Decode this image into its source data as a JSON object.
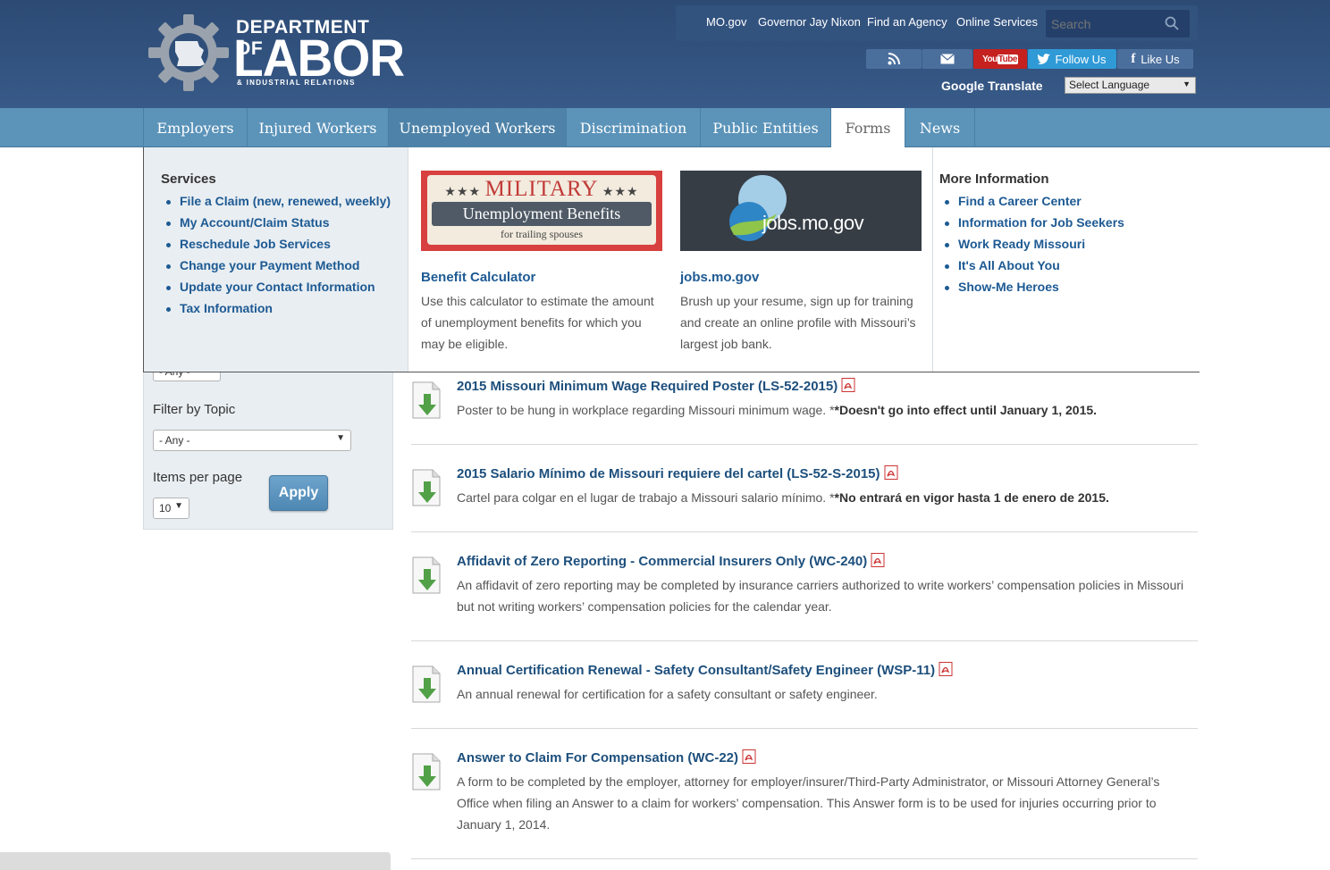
{
  "header": {
    "logo_line1": "DEPARTMENT OF",
    "logo_line2": "LABOR",
    "logo_line3": "& INDUSTRIAL RELATIONS",
    "top_links": [
      "MO.gov",
      "Governor Jay Nixon",
      "Find an Agency",
      "Online Services"
    ],
    "search_placeholder": "Search",
    "youtube_label": "YouTube",
    "follow_label": "Follow Us",
    "like_label": "Like Us",
    "google_translate": "Google Translate",
    "language_select": "Select Language"
  },
  "nav": {
    "tabs": [
      "Employers",
      "Injured Workers",
      "Unemployed Workers",
      "Discrimination",
      "Public Entities",
      "Forms",
      "News"
    ]
  },
  "mega_menu": {
    "services_heading": "Services",
    "services": [
      "File a Claim (new, renewed, weekly)",
      "My Account/Claim Status",
      "Reschedule Job Services",
      "Change your Payment Method",
      "Update your Contact Information",
      "Tax Information"
    ],
    "promo1": {
      "banner_title": "MILITARY",
      "banner_sub": "Unemployment Benefits",
      "banner_small": "for trailing spouses",
      "title": "Benefit Calculator",
      "text": "Use this calculator to estimate the amount of unemployment benefits for which you may be eligible."
    },
    "promo2": {
      "banner_text": "jobs.mo.gov",
      "title": "jobs.mo.gov",
      "text": "Brush up your resume, sign up for training and create an online profile with Missouri’s largest job bank."
    },
    "more_heading": "More Information",
    "more": [
      "Find a Career Center",
      "Information for Job Seekers",
      "Work Ready Missouri",
      "It's All About You",
      "Show-Me Heroes"
    ]
  },
  "sidebar": {
    "type_value": "- Any -",
    "topic_label": "Filter by Topic",
    "topic_value": "- Any -",
    "items_label": "Items per page",
    "items_value": "10",
    "apply_label": "Apply"
  },
  "forms": [
    {
      "title": "2015 Missouri Minimum Wage Required Poster (LS-52-2015)",
      "desc": "Poster to be hung in workplace regarding Missouri minimum wage. *",
      "note": "*Doesn't go into effect until January 1, 2015."
    },
    {
      "title": "2015 Salario Mínimo de Missouri requiere del cartel (LS-52-S-2015)",
      "desc": "Cartel para colgar en el lugar de trabajo a Missouri salario mínimo. *",
      "note": "*No entrará en vigor hasta 1 de enero de 2015."
    },
    {
      "title": "Affidavit of Zero Reporting - Commercial Insurers Only (WC-240)",
      "desc": "An affidavit of zero reporting may be completed by insurance carriers authorized to write workers’ compensation policies in Missouri but not writing workers’ compensation policies for the calendar year.",
      "note": ""
    },
    {
      "title": "Annual Certification Renewal - Safety Consultant/Safety Engineer (WSP-11)",
      "desc": "An annual renewal for certification for a safety consultant or safety engineer.",
      "note": ""
    },
    {
      "title": "Answer to Claim For Compensation (WC-22)",
      "desc": "A form to be completed by the employer, attorney for employer/insurer/Third-Party Administrator, or Missouri Attorney General’s Office when filing an Answer to a claim for workers’ compensation. This Answer form is to be used for injuries occurring prior to January 1, 2014.",
      "note": ""
    }
  ]
}
